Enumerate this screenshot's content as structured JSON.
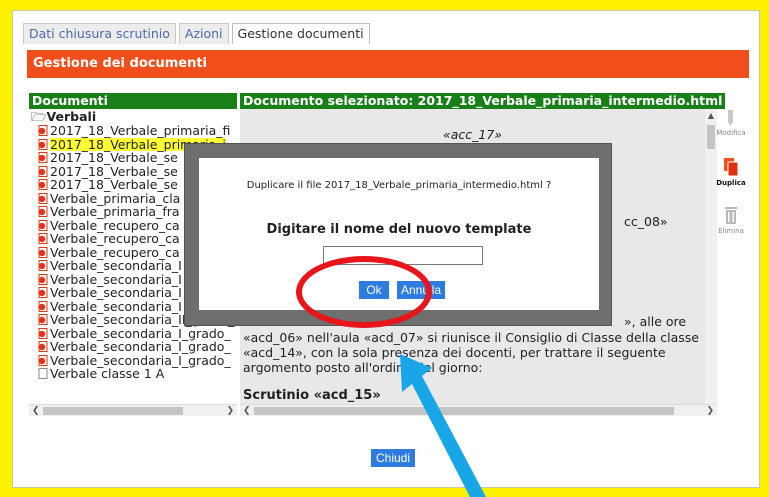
{
  "tabs": [
    {
      "label": "Dati chiusura scrutinio"
    },
    {
      "label": "Azioni"
    },
    {
      "label": "Gestione documenti"
    }
  ],
  "section_title": "Gestione dei documenti",
  "documents_header": "Documenti",
  "selected_header": "Documento selezionato: 2017_18_Verbale_primaria_intermedio.html",
  "tree": {
    "root": "Verbali",
    "items": [
      "2017_18_Verbale_primaria_fi",
      "2017_18_Verbale_primaria_i",
      "2017_18_Verbale_se",
      "2017_18_Verbale_se",
      "2017_18_Verbale_se",
      "Verbale_primaria_cla",
      "Verbale_primaria_fra",
      "Verbale_recupero_ca",
      "Verbale_recupero_ca",
      "Verbale_recupero_ca",
      "Verbale_secondaria_I",
      "Verbale_secondaria_I",
      "Verbale_secondaria_I",
      "Verbale_secondaria_I",
      "Verbale_secondaria_II_grado_",
      "Verbale_secondaria_I_grado_",
      "Verbale_secondaria_I_grado_",
      "Verbale_secondaria_I_grado_",
      "Verbale classe 1 A"
    ]
  },
  "document": {
    "acc17": "«acc_17»",
    "acc08": "cc_08»",
    "line1": "», alle ore",
    "line2": "«acd_06» nell'aula «acd_07» si riunisce il Consiglio di Classe della classe",
    "line3": "«acd_14», con la sola presenza dei docenti, per trattare il seguente",
    "line4": "argomento posto all'ordine del giorno:",
    "heading": "Scrutinio «acd_15»"
  },
  "tools": {
    "modify": "Modifica",
    "duplicate": "Duplica",
    "delete": "Elimina"
  },
  "dialog": {
    "question": "Duplicare il file 2017_18_Verbale_primaria_intermedio.html ?",
    "prompt": "Digitare il nome del nuovo template",
    "input_value": "",
    "ok_label": "Ok",
    "cancel_label": "Annulla"
  },
  "close_label": "Chiudi",
  "colors": {
    "background": "#fdf100",
    "section_bar": "#f04f1c",
    "header_green": "#198019",
    "button_blue": "#2f7ce0",
    "highlight_circle": "#e8161b",
    "arrow": "#19a6e8"
  }
}
